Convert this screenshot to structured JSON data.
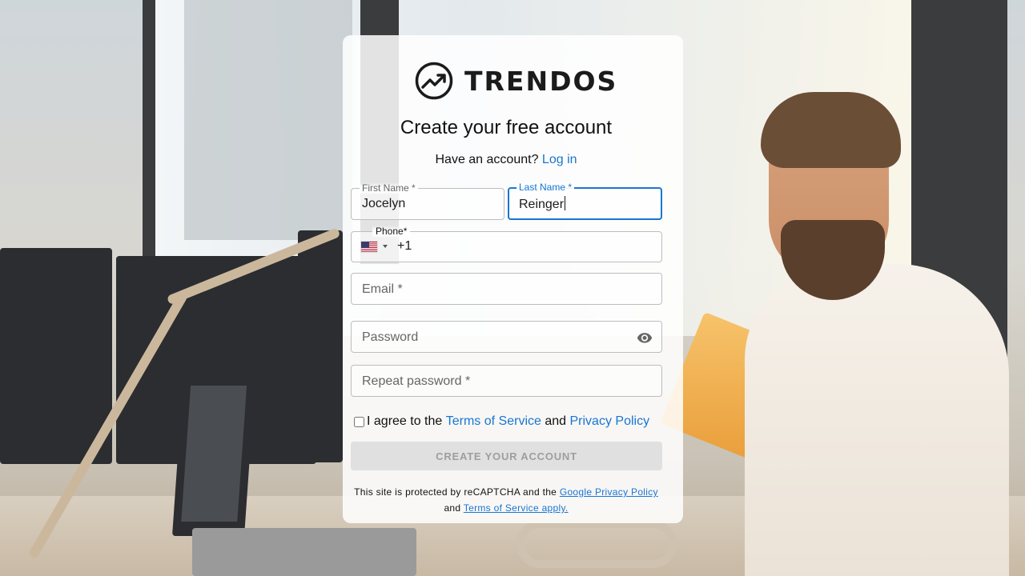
{
  "brand": {
    "name": "TRENDOS",
    "logo_icon": "trending-up-circle-icon"
  },
  "form": {
    "title": "Create your free account",
    "have_account_text": "Have an account?",
    "login_link": "Log in",
    "first_name": {
      "label": "First Name *",
      "value": "Jocelyn"
    },
    "last_name": {
      "label": "Last Name *",
      "value": "Reinger"
    },
    "phone": {
      "label": "Phone*",
      "country_icon": "us-flag-icon",
      "code": "+1"
    },
    "email": {
      "placeholder": "Email *"
    },
    "password": {
      "placeholder": "Password",
      "toggle_icon": "eye-icon"
    },
    "repeat_password": {
      "placeholder": "Repeat password *"
    },
    "agree": {
      "prefix": "I agree to the",
      "terms_link": "Terms of Service",
      "and": "and",
      "privacy_link": "Privacy Policy",
      "checked": false
    },
    "submit_label": "CREATE YOUR ACCOUNT",
    "recaptcha": {
      "text": "This site is protected by reCAPTCHA and the",
      "privacy_link": "Google Privacy Policy",
      "and": "and",
      "terms_link": "Terms of Service apply."
    }
  },
  "colors": {
    "accent": "#1976d2",
    "button_disabled_bg": "#e0e0e0",
    "button_disabled_text": "#9e9e9e"
  }
}
